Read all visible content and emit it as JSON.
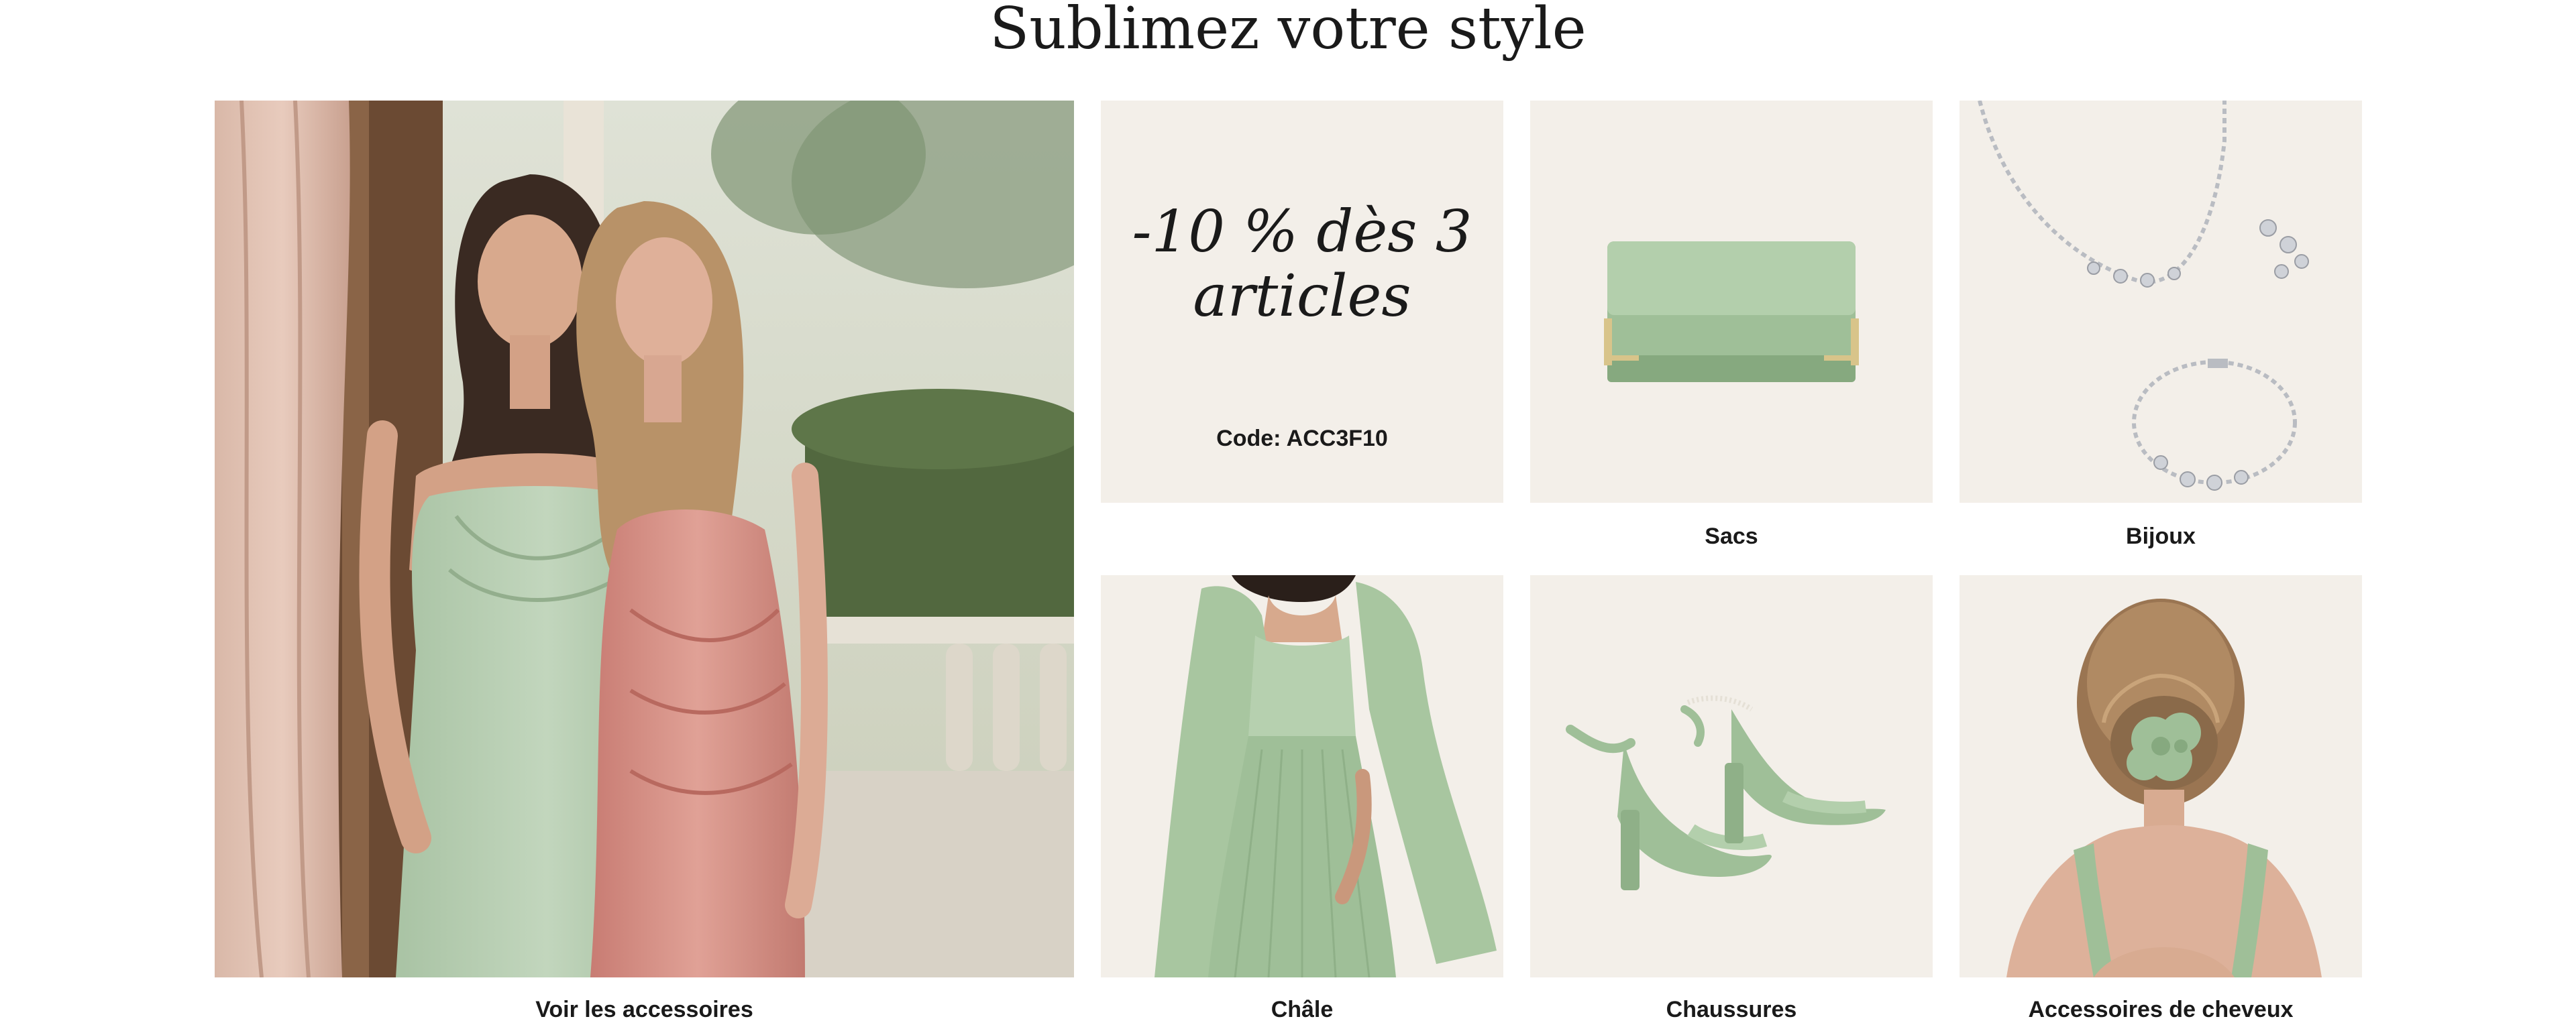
{
  "page": {
    "title": "Sublimez votre style"
  },
  "hero": {
    "label": "Voir les accessoires"
  },
  "promo": {
    "headline_line1": "-10 % dès 3",
    "headline_line2": "articles",
    "code": "Code: ACC3F10"
  },
  "categories": [
    {
      "label": "Sacs"
    },
    {
      "label": "Bijoux"
    },
    {
      "label": "Châle"
    },
    {
      "label": "Chaussures"
    },
    {
      "label": "Accessoires de cheveux"
    }
  ],
  "colors": {
    "tile_background": "#f3efe9",
    "sage_green": "#9fbf98",
    "dusty_pink": "#d48d85",
    "text": "#1a1a1a"
  }
}
